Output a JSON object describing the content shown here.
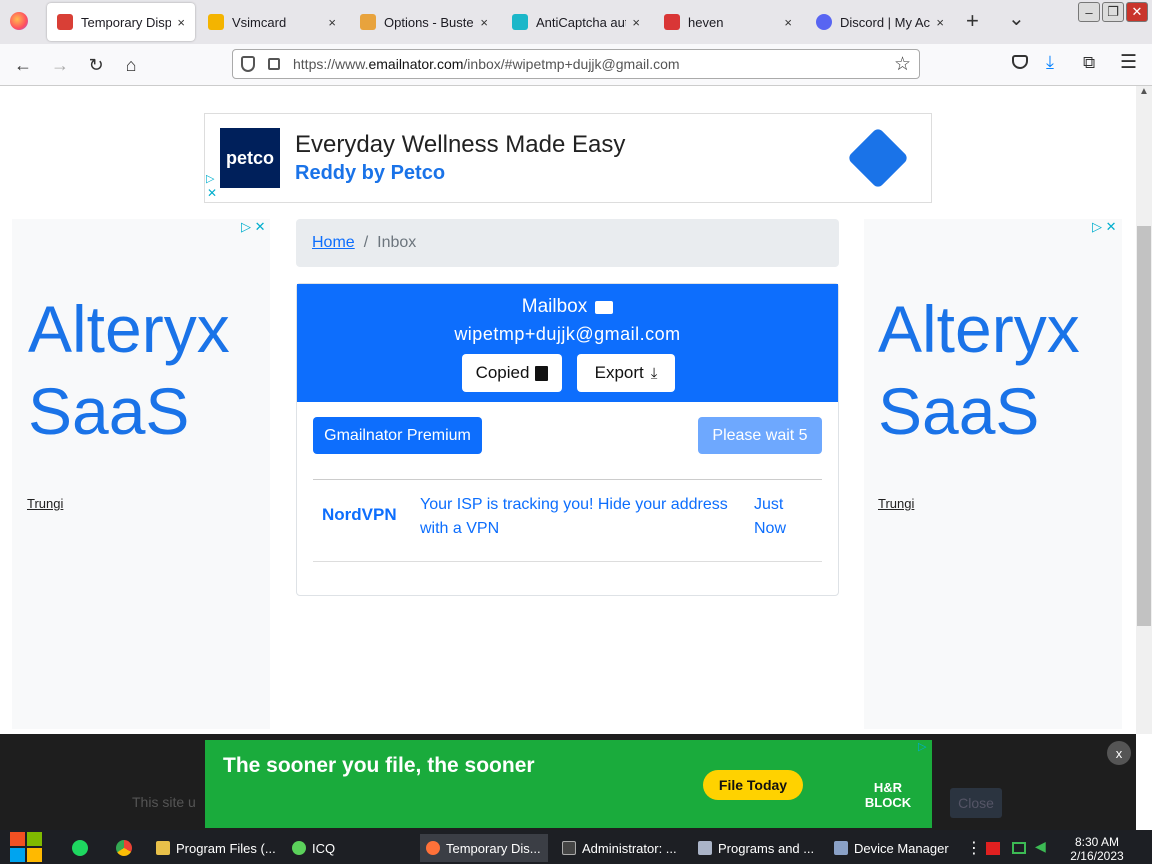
{
  "tabs": [
    {
      "label": "Temporary Dispo",
      "color": "#d93f36",
      "active": true
    },
    {
      "label": "Vsimcard",
      "color": "#f4b400"
    },
    {
      "label": "Options - Buster",
      "color": "#e8a33d"
    },
    {
      "label": "AntiCaptcha autc",
      "color": "#1bb7c9"
    },
    {
      "label": "heven",
      "color": "#d93636"
    },
    {
      "label": "Discord | My Acc",
      "color": "#5865f2"
    }
  ],
  "tab_close": "×",
  "new_tab": "+",
  "tab_list": "⌄",
  "url": {
    "prefix": "https://www.",
    "domain": "emailnator.com",
    "path": "/inbox/#wipetmp+dujjk@gmail.com"
  },
  "top_ad": {
    "logo": "petco",
    "headline": "Everyday Wellness Made Easy",
    "sub": "Reddy by Petco"
  },
  "side_ad": {
    "line1": "Alteryx",
    "line2": "SaaS",
    "sponsor": "Trungi"
  },
  "breadcrumb": {
    "home": "Home",
    "sep": "/",
    "current": "Inbox"
  },
  "mailbox": {
    "title": "Mailbox",
    "email": "wipetmp+dujjk@gmail.com",
    "copied": "Copied",
    "export": "Export"
  },
  "actions": {
    "premium": "Gmailnator Premium",
    "wait": "Please wait 5"
  },
  "messages": [
    {
      "from": "NordVPN",
      "subject_line1": "Your ISP is tracking you! Hide your address",
      "subject_line2": "with a VPN",
      "time_line1": "Just",
      "time_line2": "Now"
    }
  ],
  "bottom_ad": {
    "text": "The sooner you file, the sooner",
    "cta": "File Today",
    "brand_line1": "H&R",
    "brand_line2": "BLOCK",
    "close": "x"
  },
  "cookie": {
    "text": "This site u",
    "button": "Close"
  },
  "taskbar": {
    "items": [
      {
        "label": "Program Files (...",
        "color": "#e8c04a"
      },
      {
        "label": "ICQ",
        "color": "#5bd15b"
      },
      {
        "label": "Temporary Dis...",
        "color": "#ff7139",
        "active": true
      },
      {
        "label": "Administrator: ...",
        "color": "#444444"
      },
      {
        "label": "Programs and ...",
        "color": "#aab4c8"
      },
      {
        "label": "Device Manager",
        "color": "#8aa1c7"
      }
    ],
    "time": "8:30 AM",
    "date": "2/16/2023"
  }
}
